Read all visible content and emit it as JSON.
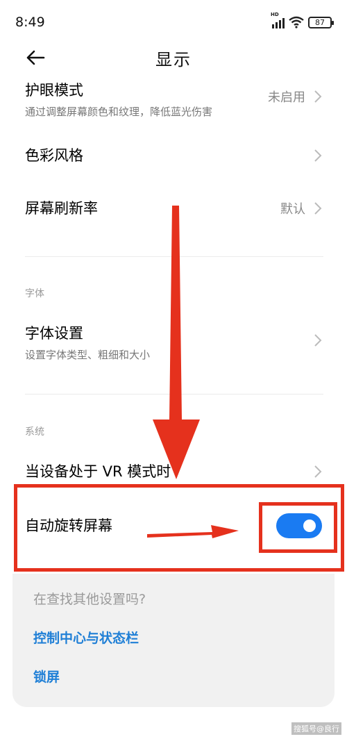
{
  "status_bar": {
    "time": "8:49",
    "network": "HD",
    "battery": "87"
  },
  "header": {
    "title": "显示"
  },
  "rows": {
    "eye_care": {
      "title": "护眼模式",
      "subtitle": "通过调整屏幕颜色和纹理，降低蓝光伤害",
      "value": "未启用"
    },
    "color_style": {
      "title": "色彩风格"
    },
    "refresh_rate": {
      "title": "屏幕刷新率",
      "value": "默认"
    },
    "font_settings": {
      "title": "字体设置",
      "subtitle": "设置字体类型、粗细和大小"
    },
    "vr_mode": {
      "title": "当设备处于 VR 模式时"
    },
    "auto_rotate": {
      "title": "自动旋转屏幕",
      "enabled": true
    }
  },
  "sections": {
    "font": "字体",
    "system": "系统"
  },
  "suggestions": {
    "title": "在查找其他设置吗?",
    "links": [
      "控制中心与状态栏",
      "锁屏"
    ]
  },
  "watermark": "搜狐号@良行",
  "colors": {
    "accent": "#1a7bf2",
    "annotation_red": "#e5311d",
    "link": "#1f7fd6"
  },
  "icons": {
    "back": "back-arrow-icon",
    "chevron": "chevron-right-icon",
    "wifi": "wifi-icon",
    "signal": "cell-signal-icon",
    "battery": "battery-icon"
  }
}
